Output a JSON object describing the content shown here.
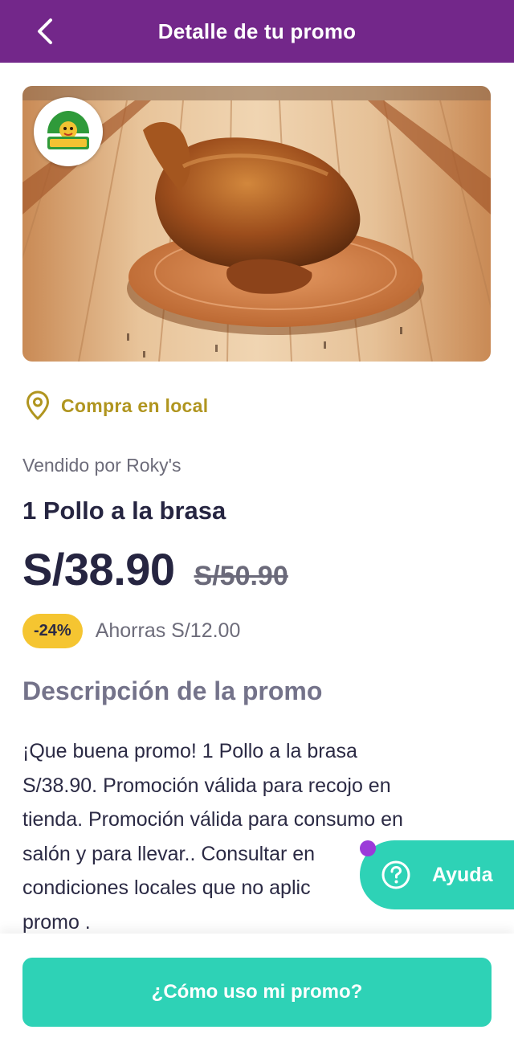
{
  "header": {
    "title": "Detalle de tu promo",
    "back_icon": "chevron-left-icon",
    "bg_color": "#73278a"
  },
  "hero": {
    "brand_logo_text": "ROKY'S",
    "image_subject": "roast-chicken-on-wooden-board"
  },
  "location": {
    "icon": "map-pin-icon",
    "label": "Compra en local"
  },
  "product": {
    "seller": "Vendido por Roky's",
    "name": "1 Pollo a la brasa",
    "price": "S/38.90",
    "old_price": "S/50.90",
    "discount": "-24%",
    "savings": "Ahorras S/12.00"
  },
  "description": {
    "title": "Descripción de la promo",
    "lines": [
      "¡Que buena promo! 1 Pollo a la brasa",
      "S/38.90. Promoción válida para recojo en",
      "tienda. Promoción válida para consumo en",
      "salón y para llevar.. Consultar en",
      "condiciones locales que no aplic",
      "promo ."
    ]
  },
  "help": {
    "icon": "question-circle-icon",
    "label": "Ayuda"
  },
  "cta": {
    "label": "¿Cómo uso mi promo?"
  },
  "colors": {
    "accent_purple": "#73278a",
    "accent_teal": "#2ed2b6",
    "badge_yellow": "#f5c531",
    "location_gold": "#b0951f"
  }
}
